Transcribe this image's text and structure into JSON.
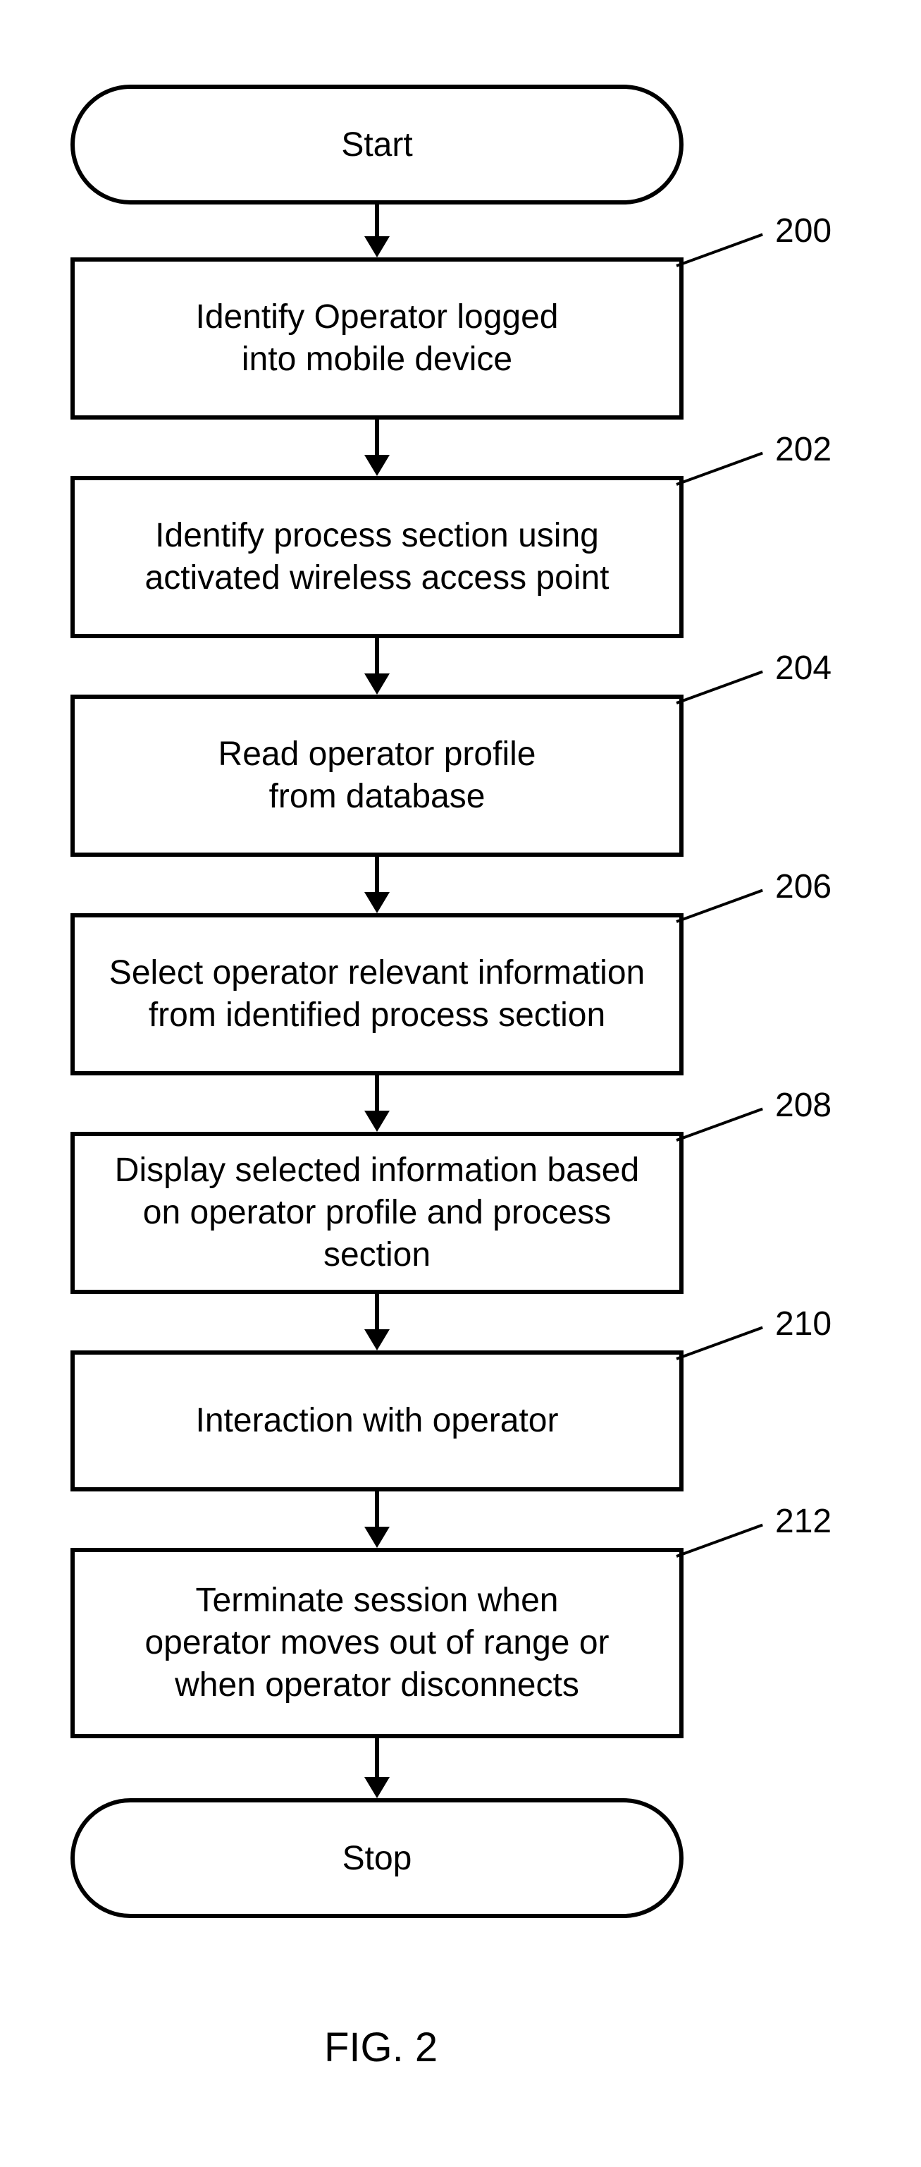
{
  "flowchart": {
    "start": "Start",
    "stop": "Stop",
    "caption": "FIG. 2",
    "steps": [
      {
        "ref": "200",
        "text": "Identify Operator logged\ninto mobile device"
      },
      {
        "ref": "202",
        "text": "Identify process section using\nactivated wireless access point"
      },
      {
        "ref": "204",
        "text": "Read operator profile\nfrom database"
      },
      {
        "ref": "206",
        "text": "Select operator relevant information\nfrom identified process section"
      },
      {
        "ref": "208",
        "text": "Display selected information based\non operator profile and process section"
      },
      {
        "ref": "210",
        "text": "Interaction with operator"
      },
      {
        "ref": "212",
        "text": "Terminate session when\noperator moves out of range or\nwhen operator disconnects"
      }
    ]
  }
}
